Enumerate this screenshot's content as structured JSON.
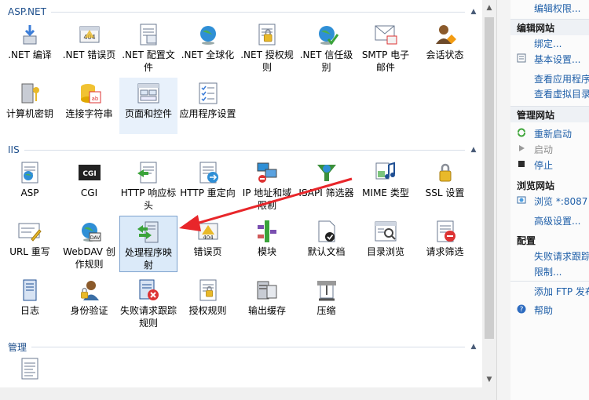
{
  "sections": {
    "aspnet": "ASP.NET",
    "iis": "IIS",
    "manage": "管理"
  },
  "aspnet_tiles": [
    {
      "label": ".NET 编译",
      "icon": "net-compile-icon"
    },
    {
      "label": ".NET 错误页",
      "icon": "net-error-pages-icon"
    },
    {
      "label": ".NET 配置文件",
      "icon": "net-profile-icon"
    },
    {
      "label": ".NET 全球化",
      "icon": "globe-icon"
    },
    {
      "label": ".NET 授权规则",
      "icon": "authorization-lock-icon"
    },
    {
      "label": ".NET 信任级别",
      "icon": "trust-level-icon"
    },
    {
      "label": "SMTP 电子邮件",
      "icon": "email-icon"
    },
    {
      "label": "会话状态",
      "icon": "session-state-icon"
    },
    {
      "label": "计算机密钥",
      "icon": "machine-key-icon"
    },
    {
      "label": "连接字符串",
      "icon": "connection-string-icon"
    },
    {
      "label": "页面和控件",
      "icon": "pages-controls-icon"
    },
    {
      "label": "应用程序设置",
      "icon": "app-settings-icon"
    }
  ],
  "iis_tiles": [
    {
      "label": "ASP",
      "icon": "asp-icon"
    },
    {
      "label": "CGI",
      "icon": "cgi-icon"
    },
    {
      "label": "HTTP 响应标头",
      "icon": "http-headers-icon"
    },
    {
      "label": "HTTP 重定向",
      "icon": "http-redirect-icon"
    },
    {
      "label": "IP 地址和域限制",
      "icon": "ip-restrict-icon"
    },
    {
      "label": "ISAPI 筛选器",
      "icon": "isapi-filter-icon"
    },
    {
      "label": "MIME 类型",
      "icon": "mime-types-icon"
    },
    {
      "label": "SSL 设置",
      "icon": "ssl-lock-icon"
    },
    {
      "label": "URL 重写",
      "icon": "url-rewrite-icon"
    },
    {
      "label": "WebDAV 创作规则",
      "icon": "webdav-icon"
    },
    {
      "label": "处理程序映射",
      "icon": "handler-mappings-icon"
    },
    {
      "label": "错误页",
      "icon": "error-pages-icon"
    },
    {
      "label": "模块",
      "icon": "modules-icon"
    },
    {
      "label": "默认文档",
      "icon": "default-document-icon"
    },
    {
      "label": "目录浏览",
      "icon": "directory-browsing-icon"
    },
    {
      "label": "请求筛选",
      "icon": "request-filtering-icon"
    },
    {
      "label": "日志",
      "icon": "logging-icon"
    },
    {
      "label": "身份验证",
      "icon": "authentication-icon"
    },
    {
      "label": "失败请求跟踪规则",
      "icon": "failed-request-icon"
    },
    {
      "label": "授权规则",
      "icon": "authorization-rules-icon"
    },
    {
      "label": "输出缓存",
      "icon": "output-cache-icon"
    },
    {
      "label": "压缩",
      "icon": "compression-icon"
    }
  ],
  "manage_tiles": [
    {
      "label": "",
      "icon": "configuration-editor-icon"
    }
  ],
  "actions": {
    "edit_permissions": "编辑权限...",
    "edit_site_head": "编辑网站",
    "bindings": "绑定...",
    "basic_settings": "基本设置...",
    "view_apps": "查看应用程序",
    "view_vdirs": "查看虚拟目录",
    "manage_site_head": "管理网站",
    "restart": "重新启动",
    "start": "启动",
    "stop": "停止",
    "browse_site_head": "浏览网站",
    "browse_port": "浏览 *:8087 (",
    "advanced_settings": "高级设置...",
    "config_head": "配置",
    "failed_request_tracing": "失败请求跟踪",
    "limits": "限制...",
    "add_ftp": "添加 FTP 发布",
    "help": "帮助"
  },
  "colors": {
    "link": "#1f5fa8",
    "section_title": "#1e4f8c",
    "annotation_arrow": "#e8262a",
    "selected_tile": "#dbeaf9"
  }
}
